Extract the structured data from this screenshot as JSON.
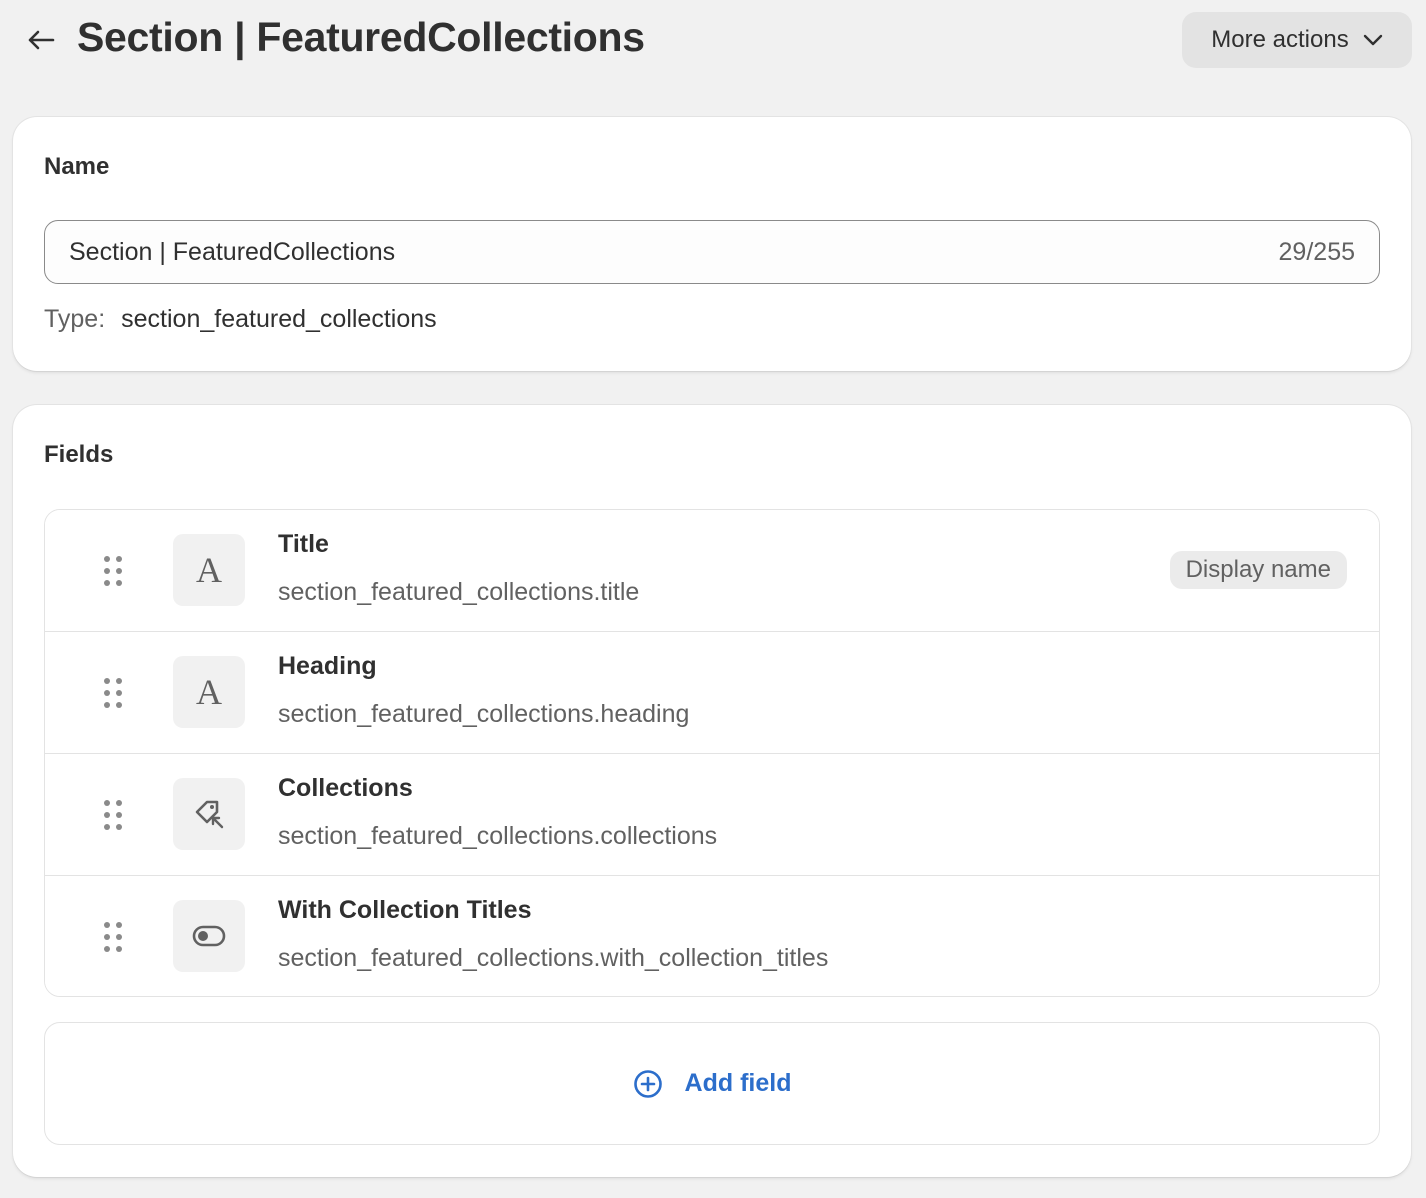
{
  "header": {
    "title": "Section | FeaturedCollections",
    "more_actions_label": "More actions"
  },
  "name_card": {
    "heading": "Name",
    "input_value": "Section | FeaturedCollections",
    "char_count": "29/255",
    "type_label": "Type:",
    "type_value": "section_featured_collections"
  },
  "fields_card": {
    "heading": "Fields",
    "fields": [
      {
        "title": "Title",
        "key": "section_featured_collections.title",
        "icon": "text-icon",
        "icon_char": "A",
        "badge": "Display name"
      },
      {
        "title": "Heading",
        "key": "section_featured_collections.heading",
        "icon": "text-icon",
        "icon_char": "A"
      },
      {
        "title": "Collections",
        "key": "section_featured_collections.collections",
        "icon": "collection-reference-icon"
      },
      {
        "title": "With Collection Titles",
        "key": "section_featured_collections.with_collection_titles",
        "icon": "toggle-icon"
      }
    ],
    "add_field_label": "Add field"
  },
  "colors": {
    "background": "#f1f1f1",
    "card": "#ffffff",
    "text": "#303030",
    "muted_text": "#616161",
    "link": "#2c6ecb"
  }
}
